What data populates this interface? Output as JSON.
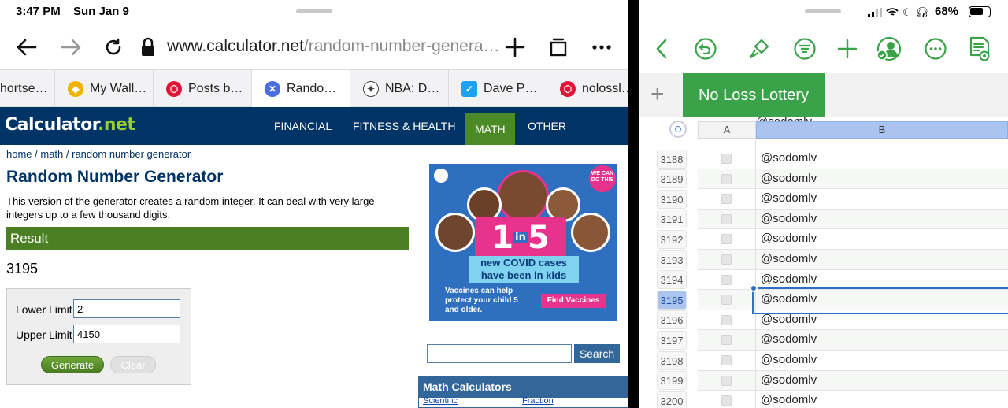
{
  "status": {
    "time": "3:47 PM",
    "date": "Sun Jan 9",
    "battery": "68%"
  },
  "browser": {
    "url_host": "www.calculator.net",
    "url_path": "/random-number-genera…",
    "tabs": [
      {
        "label": "hortse…",
        "icon": "generic-icon",
        "color": "#888888"
      },
      {
        "label": "My Wall…",
        "icon": "shield-icon",
        "color": "#f0b400"
      },
      {
        "label": "Posts b…",
        "icon": "hive-icon",
        "color": "#e31337"
      },
      {
        "label": "Rando…",
        "icon": "close-icon",
        "color": "#4a6ee0",
        "active": true
      },
      {
        "label": "NBA: D…",
        "icon": "team-logo-icon",
        "color": "#444444"
      },
      {
        "label": "Dave P…",
        "icon": "twitter-icon",
        "color": "#1da1f2"
      },
      {
        "label": "nolossl…",
        "icon": "hive-icon",
        "color": "#e31337"
      }
    ]
  },
  "site": {
    "logo_main": "Calculator",
    "logo_dot": ".",
    "logo_net": "net",
    "nav": [
      "FINANCIAL",
      "FITNESS & HEALTH",
      "MATH",
      "OTHER"
    ],
    "breadcrumb": {
      "home": "home",
      "sep1": " / ",
      "math": "math",
      "sep2": " / ",
      "page": "random number generator"
    },
    "title": "Random Number Generator",
    "description": "This version of the generator creates a random integer. It can deal with very large integers up to a few thousand digits.",
    "result_label": "Result",
    "result_value": "3195",
    "form": {
      "lower_label": "Lower Limit",
      "lower_value": "2",
      "upper_label": "Upper Limit",
      "upper_value": "4150",
      "generate_label": "Generate",
      "clear_label": "Clear"
    },
    "ad": {
      "badge_1": "1",
      "badge_in": "in",
      "badge_5": "5",
      "headline": "new COVID cases have been in kids",
      "sub": "Vaccines can help protect your child 5 and older.",
      "cta": "Find Vaccines",
      "corner_text": "WE CAN DO THIS"
    },
    "search_label": "Search",
    "math_calculators": "Math Calculators",
    "math_links": [
      "Scientific",
      "Fraction"
    ]
  },
  "numbers": {
    "sheet_name": "No Loss Lottery",
    "columns": [
      "A",
      "B"
    ],
    "partial_top": "@sodomlv",
    "rows": [
      {
        "num": "3188",
        "b": "@sodomlv"
      },
      {
        "num": "3189",
        "b": "@sodomlv"
      },
      {
        "num": "3190",
        "b": "@sodomlv"
      },
      {
        "num": "3191",
        "b": "@sodomlv"
      },
      {
        "num": "3192",
        "b": "@sodomlv"
      },
      {
        "num": "3193",
        "b": "@sodomlv"
      },
      {
        "num": "3194",
        "b": "@sodomlv"
      },
      {
        "num": "3195",
        "b": "@sodomlv",
        "selected": true
      },
      {
        "num": "3196",
        "b": "@sodomlv"
      },
      {
        "num": "3197",
        "b": "@sodomlv"
      },
      {
        "num": "3198",
        "b": "@sodomlv"
      },
      {
        "num": "3199",
        "b": "@sodomlv"
      },
      {
        "num": "3200",
        "b": "@sodomlv"
      }
    ],
    "accent": "#3aa34a"
  }
}
